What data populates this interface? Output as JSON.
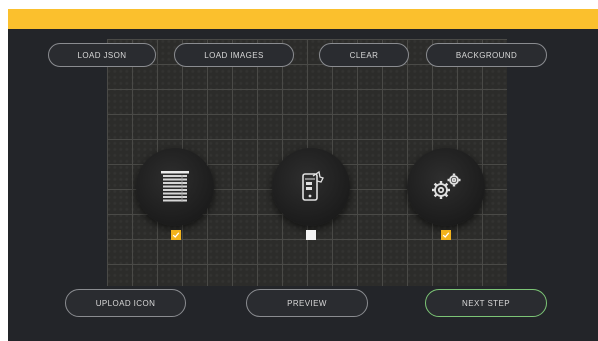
{
  "toolbar": {
    "load_json": "LOAD JSON",
    "load_images": "LOAD IMAGES",
    "clear": "CLEAR",
    "background": "BACKGROUND"
  },
  "items": [
    {
      "icon": "blinds-icon",
      "checked": true
    },
    {
      "icon": "phone-touch-icon",
      "checked": false
    },
    {
      "icon": "gears-icon",
      "checked": true
    }
  ],
  "footer": {
    "upload_icon": "UPLOAD ICON",
    "preview": "PREVIEW",
    "next_step": "NEXT STEP"
  },
  "colors": {
    "accent_bar": "#fbc02d",
    "checkbox_on": "#f2b31c",
    "next_border": "#7cc576"
  }
}
